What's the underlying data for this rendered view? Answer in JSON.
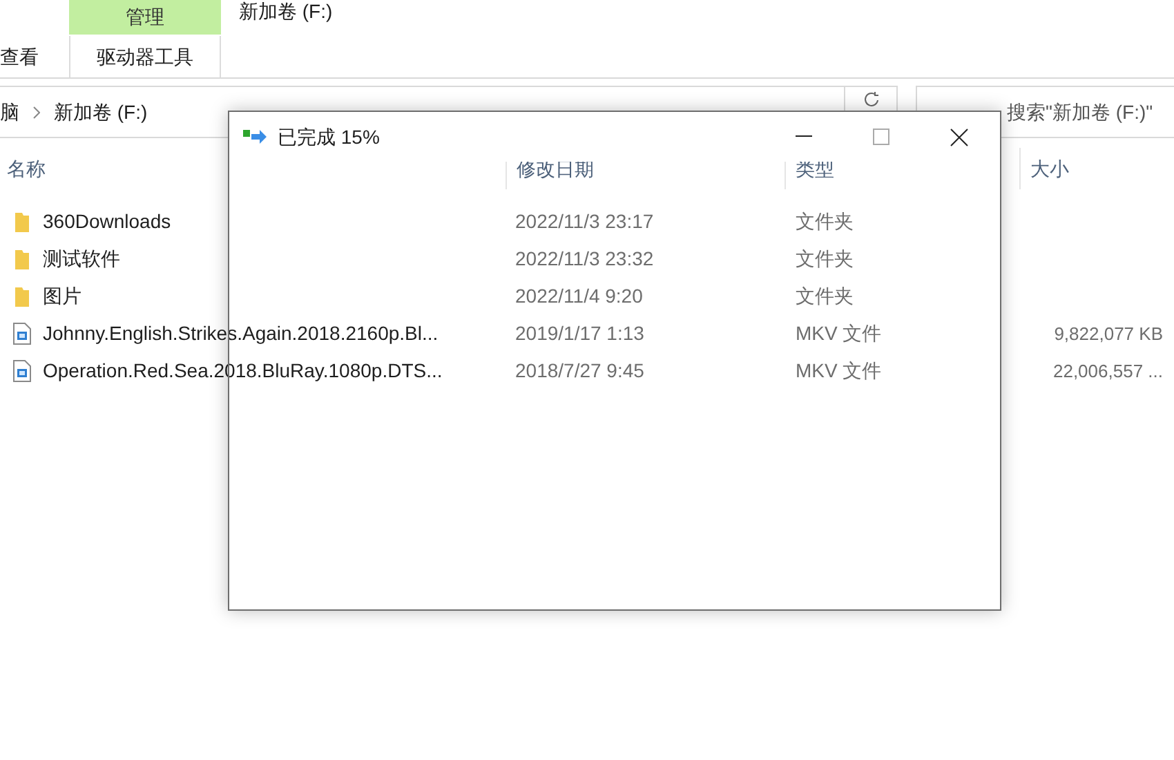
{
  "ribbon": {
    "tabs": [
      {
        "label": "查看",
        "selected": false
      },
      {
        "label": "驱动器工具",
        "selected": false
      }
    ],
    "context_tab": "管理",
    "window_title": "新加卷 (F:)"
  },
  "address_bar": {
    "breadcrumb": [
      "脑",
      "新加卷 (F:)"
    ]
  },
  "search": {
    "placeholder": "搜索\"新加卷 (F:)\""
  },
  "table": {
    "columns": [
      "名称",
      "修改日期",
      "类型",
      "大小"
    ],
    "rows": [
      {
        "kind": "folder",
        "name": "360Downloads",
        "modified": "2022/11/3 23:17",
        "type": "文件夹",
        "size": ""
      },
      {
        "kind": "folder",
        "name": "测试软件",
        "modified": "2022/11/3 23:32",
        "type": "文件夹",
        "size": ""
      },
      {
        "kind": "folder",
        "name": "图片",
        "modified": "2022/11/4 9:20",
        "type": "文件夹",
        "size": ""
      },
      {
        "kind": "file",
        "name": "Johnny.English.Strikes.Again.2018.2160p.Bl...",
        "modified": "2019/1/17 1:13",
        "type": "MKV 文件",
        "size": "9,822,077 KB"
      },
      {
        "kind": "file",
        "name": "Operation.Red.Sea.2018.BluRay.1080p.DTS...",
        "modified": "2018/7/27 9:45",
        "type": "MKV 文件",
        "size": "22,006,557 ..."
      }
    ]
  },
  "dialog": {
    "title": "已完成 15%"
  }
}
